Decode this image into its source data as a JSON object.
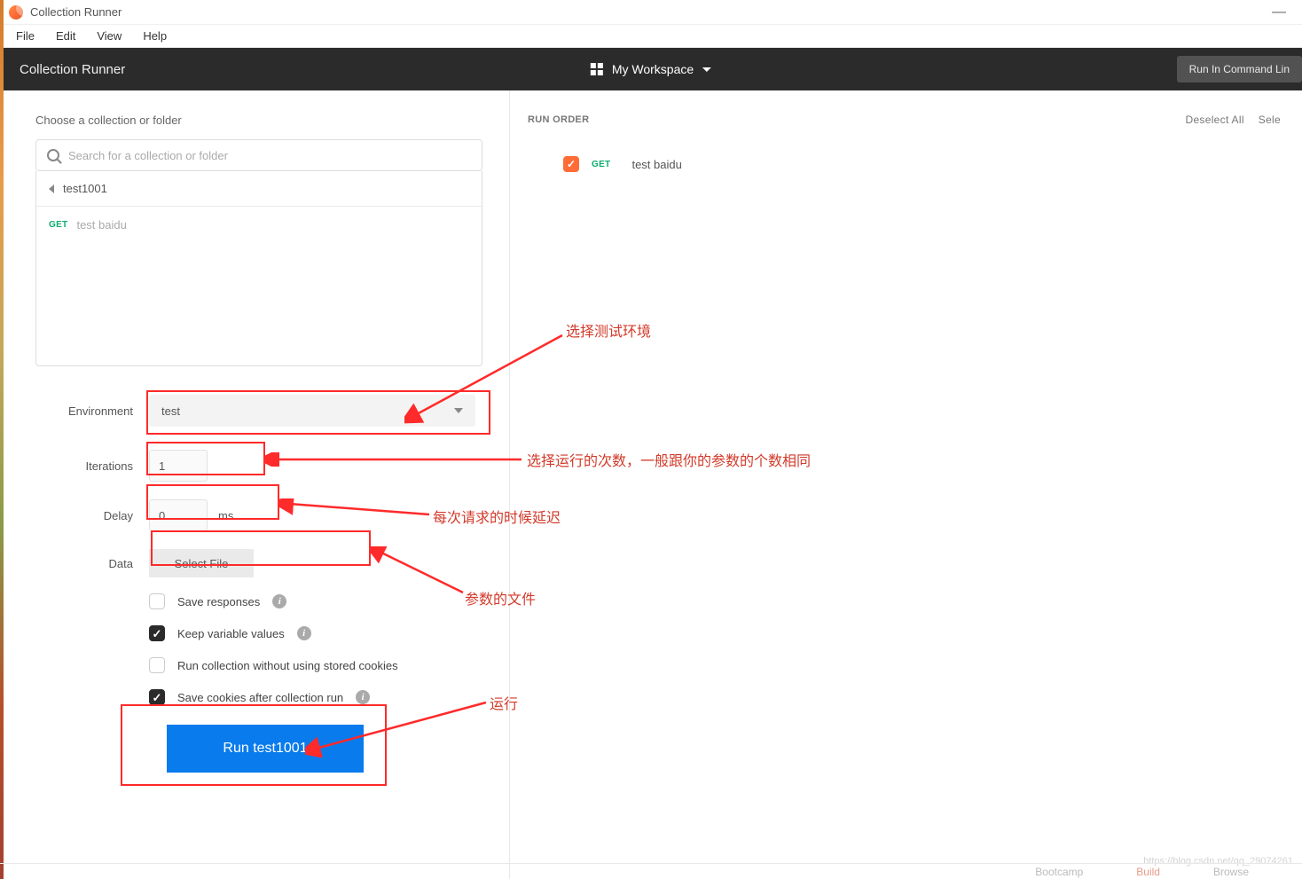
{
  "titlebar": {
    "title": "Collection Runner"
  },
  "menu": {
    "file": "File",
    "edit": "Edit",
    "view": "View",
    "help": "Help"
  },
  "topbar": {
    "title": "Collection Runner",
    "workspace": "My Workspace",
    "cmd_btn": "Run In Command Lin"
  },
  "left": {
    "choose_label": "Choose a collection or folder",
    "search_placeholder": "Search for a collection or folder",
    "collection_name": "test1001",
    "sub_method": "GET",
    "sub_name": "test baidu",
    "form": {
      "environment_label": "Environment",
      "environment_value": "test",
      "iterations_label": "Iterations",
      "iterations_value": "1",
      "delay_label": "Delay",
      "delay_value": "0",
      "delay_unit": "ms",
      "data_label": "Data",
      "select_file": "Select File",
      "save_responses": "Save responses",
      "keep_vars": "Keep variable values",
      "no_cookies": "Run collection without using stored cookies",
      "save_cookies": "Save cookies after collection run",
      "run_btn": "Run test1001"
    }
  },
  "right": {
    "run_order": "RUN ORDER",
    "deselect": "Deselect All",
    "select": "Sele",
    "req_method": "GET",
    "req_name": "test baidu"
  },
  "annotations": {
    "env": "选择测试环境",
    "iter": "选择运行的次数，一般跟你的参数的个数相同",
    "delay": "每次请求的时候延迟",
    "data": "参数的文件",
    "run": "运行"
  },
  "watermark": "https://blog.csdn.net/qq_29074261",
  "bottom": {
    "bootcamp": "Bootcamp",
    "build": "Build",
    "browse": "Browse"
  }
}
